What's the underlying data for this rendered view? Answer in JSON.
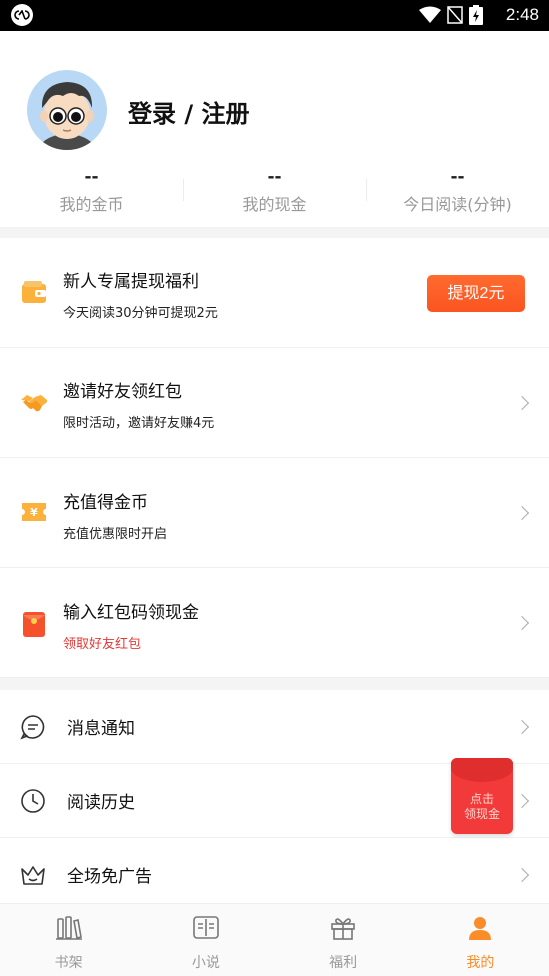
{
  "status_bar": {
    "time": "2:48"
  },
  "profile": {
    "login_label": "登录 / 注册",
    "stats": [
      {
        "value": "--",
        "label": "我的金币"
      },
      {
        "value": "--",
        "label": "我的现金"
      },
      {
        "value": "--",
        "label": "今日阅读(分钟)"
      }
    ]
  },
  "cards": [
    {
      "title": "新人专属提现福利",
      "subtitle": "今天阅读30分钟可提现2元",
      "button": "提现2元",
      "icon": "wallet-icon"
    },
    {
      "title": "邀请好友领红包",
      "subtitle": "限时活动，邀请好友赚4元",
      "icon": "handshake-icon"
    },
    {
      "title": "充值得金币",
      "subtitle": "充值优惠限时开启",
      "icon": "yuan-ticket-icon"
    },
    {
      "title": "输入红包码领现金",
      "subtitle": "领取好友红包",
      "icon": "red-envelope-icon"
    }
  ],
  "menu": [
    {
      "label": "消息通知",
      "icon": "message-icon"
    },
    {
      "label": "阅读历史",
      "icon": "clock-icon"
    },
    {
      "label": "全场免广告",
      "icon": "crown-icon"
    }
  ],
  "float_redpacket": {
    "line1": "点击",
    "line2": "领现金"
  },
  "tabs": [
    {
      "label": "书架",
      "icon": "bookshelf-icon"
    },
    {
      "label": "小说",
      "icon": "book-icon"
    },
    {
      "label": "福利",
      "icon": "gift-icon"
    },
    {
      "label": "我的",
      "icon": "user-icon"
    }
  ],
  "colors": {
    "accent": "#fb8c2a",
    "button": "#fb5420",
    "red": "#e53935",
    "redpacket": "#f23a3a"
  }
}
